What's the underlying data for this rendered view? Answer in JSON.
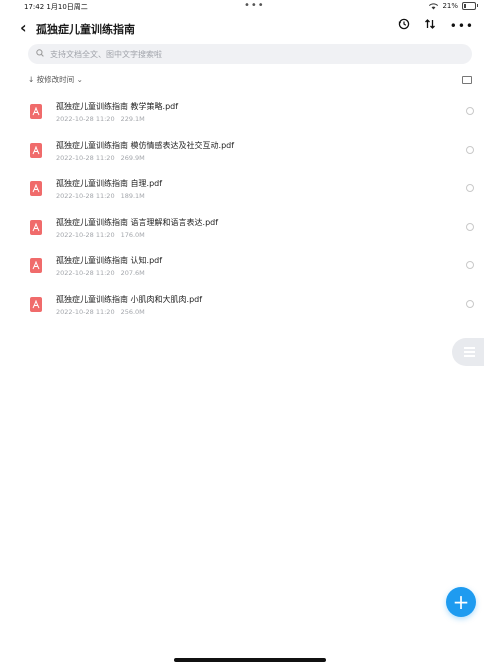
{
  "status": {
    "time": "17:42",
    "date": "1月10日周二",
    "battery": "21%"
  },
  "header": {
    "title": "孤独症儿童训练指南"
  },
  "search": {
    "placeholder": "支持文档全文、图中文字搜索啦"
  },
  "sort": {
    "label": "按修改时间"
  },
  "files": [
    {
      "name": "孤独症儿童训练指南 教学策略.pdf",
      "date": "2022-10-28 11:20",
      "size": "229.1M"
    },
    {
      "name": "孤独症儿童训练指南 模仿情感表达及社交互动.pdf",
      "date": "2022-10-28 11:20",
      "size": "269.9M"
    },
    {
      "name": "孤独症儿童训练指南 自理.pdf",
      "date": "2022-10-28 11:20",
      "size": "189.1M"
    },
    {
      "name": "孤独症儿童训练指南   语言理解和语言表达.pdf",
      "date": "2022-10-28 11:20",
      "size": "176.0M"
    },
    {
      "name": "孤独症儿童训练指南   认知.pdf",
      "date": "2022-10-28 11:20",
      "size": "207.6M"
    },
    {
      "name": "孤独症儿童训练指南 小肌肉和大肌肉.pdf",
      "date": "2022-10-28 11:20",
      "size": "256.0M"
    }
  ],
  "colors": {
    "accent": "#1e9bf0",
    "pdf": "#f06b6b",
    "search_bg": "#f0f1f4"
  },
  "icons": {
    "back": "chevron-left-icon",
    "history": "history-icon",
    "sort": "sort-arrows-icon",
    "more": "more-icon",
    "add": "plus-icon"
  }
}
